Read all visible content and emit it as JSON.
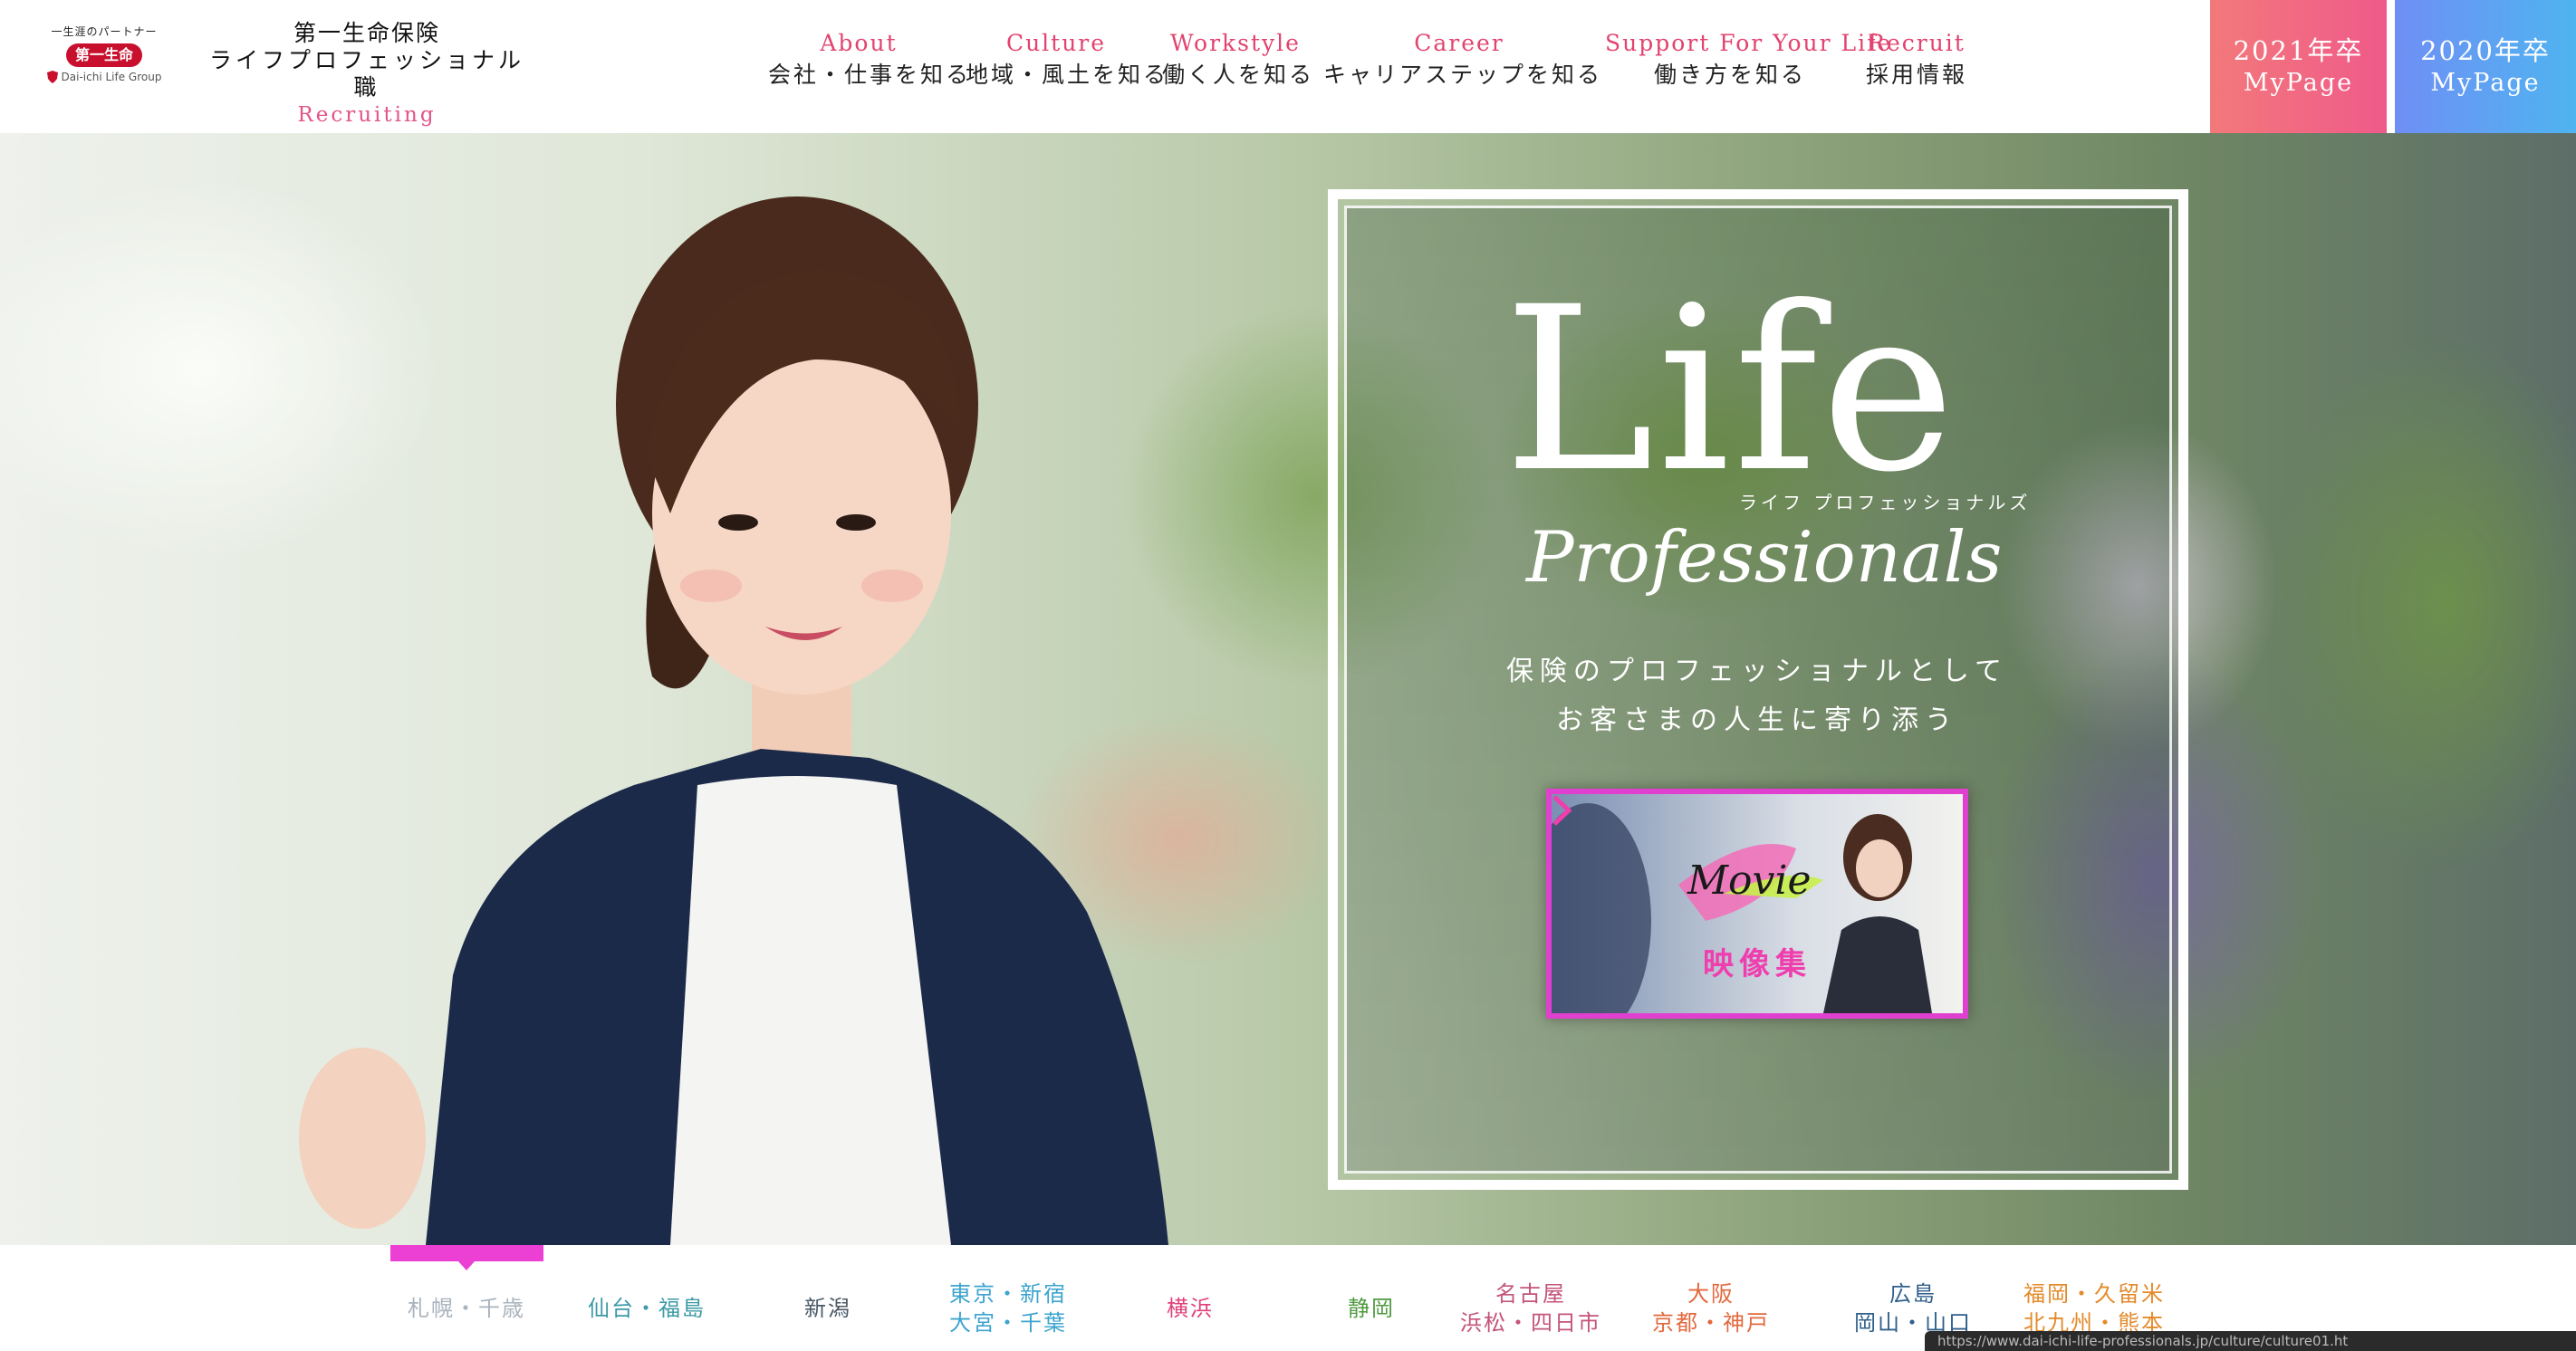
{
  "brand": {
    "tagline": "一生涯のパートナー",
    "badge": "第一生命",
    "group": "Dai-ichi Life Group"
  },
  "site_title": {
    "line1": "第一生命保険",
    "line2": "ライフプロフェッショナル職",
    "line3": "Recruiting"
  },
  "nav": [
    {
      "en": "About",
      "ja": "会社・仕事を知る"
    },
    {
      "en": "Culture",
      "ja": "地域・風土を知る"
    },
    {
      "en": "Workstyle",
      "ja": "働く人を知る"
    },
    {
      "en": "Career",
      "ja": "キャリアステップを知る"
    },
    {
      "en": "Support For Your Life",
      "ja": "働き方を知る"
    },
    {
      "en": "Recruit",
      "ja": "採用情報"
    }
  ],
  "mypage": [
    {
      "year": "2021年卒",
      "label": "MyPage",
      "color": "#f2797a"
    },
    {
      "year": "2020年卒",
      "label": "MyPage",
      "color": "#5fa6f2"
    }
  ],
  "hero": {
    "logo_big": "Life",
    "logo_script": "Professionals",
    "logo_kana": "ライフ プロフェッショナルズ",
    "tagline_line1": "保険のプロフェッショナルとして",
    "tagline_line2": "お客さまの人生に寄り添う",
    "movie_word": "Movie",
    "movie_label": "映像集"
  },
  "regions": [
    {
      "lines": [
        "札幌・千歳"
      ],
      "color": "#a9b3bd",
      "selected": true
    },
    {
      "lines": [
        "仙台・福島"
      ],
      "color": "#3d9aa6"
    },
    {
      "lines": [
        "新潟"
      ],
      "color": "#4a5a66"
    },
    {
      "lines": [
        "東京・新宿",
        "大宮・千葉"
      ],
      "color": "#3da4cf"
    },
    {
      "lines": [
        "横浜"
      ],
      "color": "#e0407a"
    },
    {
      "lines": [
        "静岡"
      ],
      "color": "#4f9a3f"
    },
    {
      "lines": [
        "名古屋",
        "浜松・四日市"
      ],
      "color": "#c4547c"
    },
    {
      "lines": [
        "大阪",
        "京都・神戸"
      ],
      "color": "#e3683d"
    },
    {
      "lines": [
        "広島",
        "岡山・山口"
      ],
      "color": "#2f5f8c"
    },
    {
      "lines": [
        "福岡・久留米",
        "北九州・熊本"
      ],
      "color": "#e48a2a"
    }
  ],
  "status_url": "https://www.dai-ichi-life-professionals.jp/culture/culture01.ht"
}
